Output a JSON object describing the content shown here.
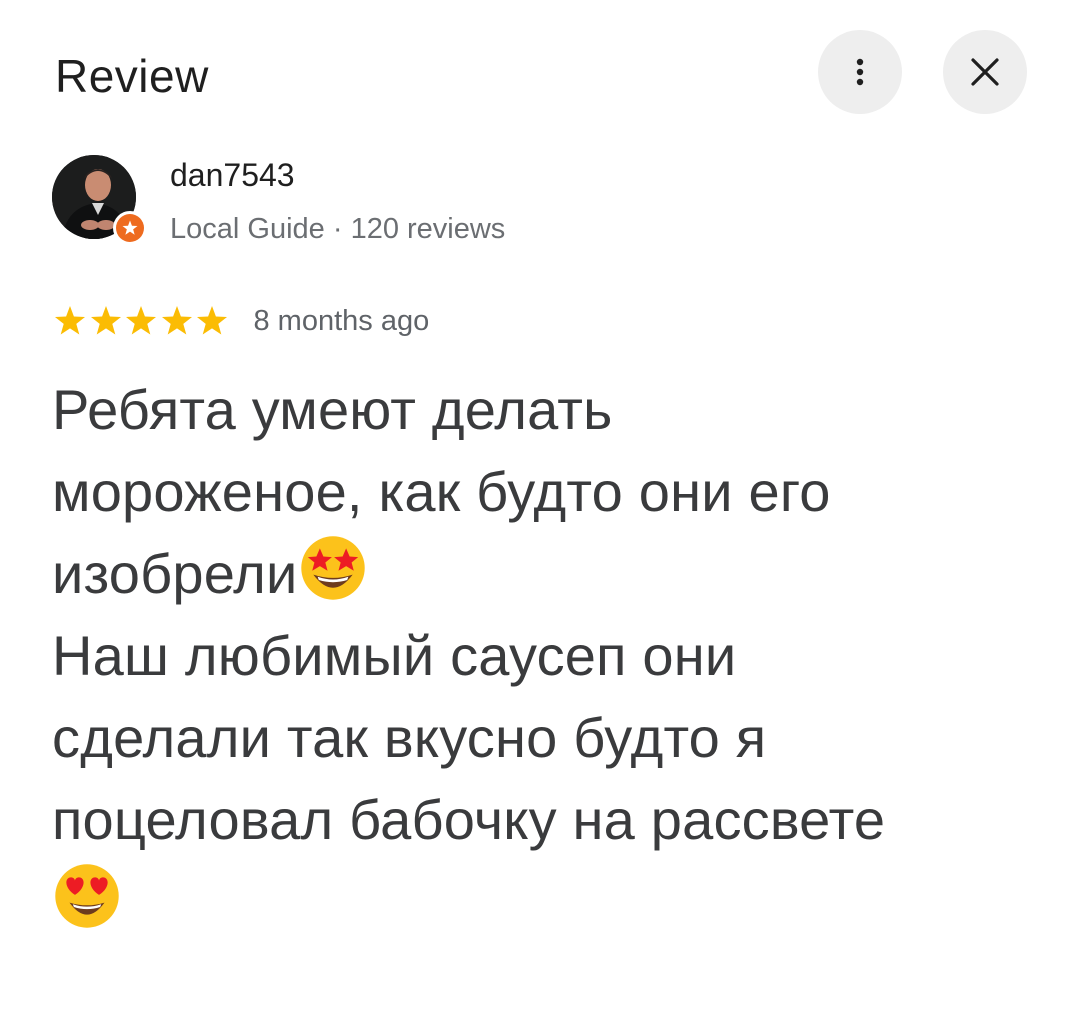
{
  "header": {
    "title": "Review",
    "more_icon": "more-vert-icon",
    "close_icon": "close-icon"
  },
  "reviewer": {
    "name": "dan7543",
    "badge": "Local Guide",
    "separator": " · ",
    "review_count": "120 reviews",
    "badge_color": "#ee6b1f"
  },
  "rating": {
    "stars": 5,
    "max": 5,
    "star_color": "#fbbc04",
    "time_ago": "8 months ago"
  },
  "review": {
    "line1": "Ребята умеют делать",
    "line2": "мороженое, как будто они его",
    "line3": "изобрели",
    "emoji1": "star-struck-emoji",
    "line4": "Наш любимый саусеп они",
    "line5": "сделали так вкусно будто я",
    "line6": "поцеловал бабочку на рассвете",
    "emoji2": "heart-eyes-emoji"
  }
}
